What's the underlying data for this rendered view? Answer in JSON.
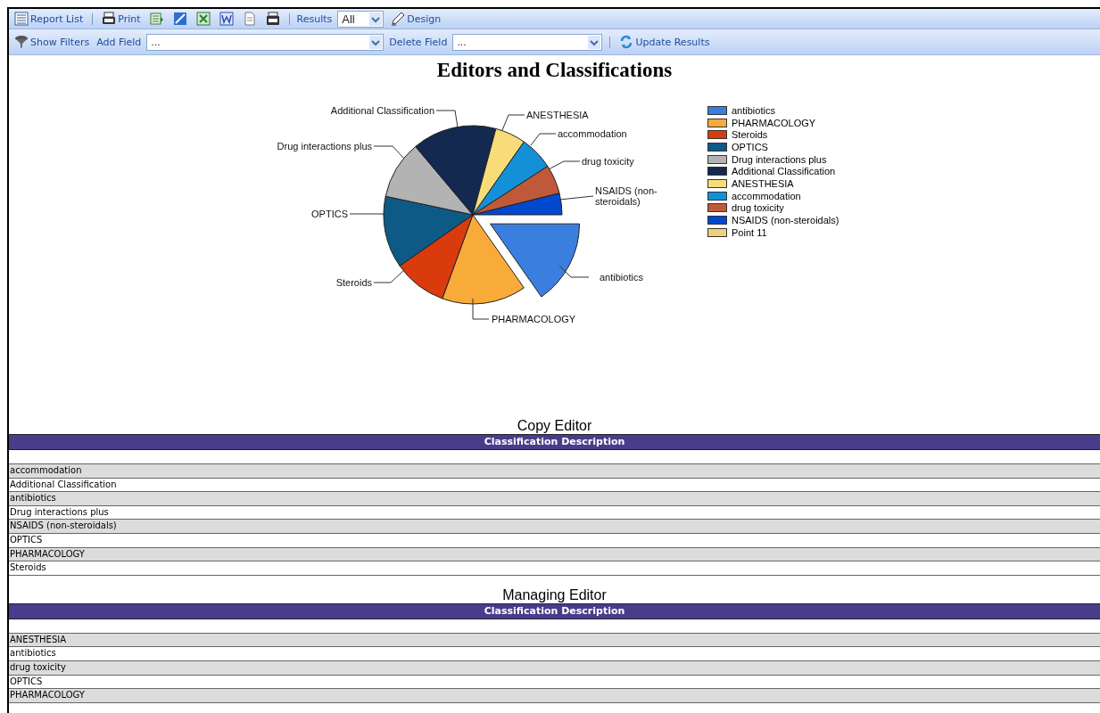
{
  "toolbar_top": [
    {
      "kind": "button",
      "label": "Report List"
    },
    {
      "kind": "separator"
    },
    {
      "kind": "button",
      "label": "Print"
    },
    {
      "kind": "icon"
    },
    {
      "kind": "icon"
    },
    {
      "kind": "icon"
    },
    {
      "kind": "icon"
    },
    {
      "kind": "icon"
    },
    {
      "kind": "icon"
    },
    {
      "kind": "separator"
    },
    {
      "kind": "label",
      "label": "Results"
    },
    {
      "kind": "select",
      "value": "All"
    },
    {
      "kind": "button",
      "label": "Design"
    }
  ],
  "toolbar_bottom": [
    {
      "kind": "button",
      "label": "Show Filters"
    },
    {
      "kind": "label",
      "label": "Add Field"
    },
    {
      "kind": "select",
      "value": "..."
    },
    {
      "kind": "label",
      "label": "Delete Field"
    },
    {
      "kind": "select",
      "value": "..."
    },
    {
      "kind": "separator"
    },
    {
      "kind": "button",
      "label": "Update Results"
    }
  ],
  "report_title": "Editors and Classifications",
  "pie_labels": [
    "Additional Classification",
    "ANESTHESIA",
    "accommodation",
    "Drug interactions plus",
    "drug toxicity",
    "NSAIDS (non-steroidals)",
    "OPTICS",
    "antibiotics",
    "Steroids",
    "PHARMACOLOGY"
  ],
  "legend": [
    {
      "label": "antibiotics",
      "color": "#3a7fe0"
    },
    {
      "label": "PHARMACOLOGY",
      "color": "#f9ab3a"
    },
    {
      "label": "Steroids",
      "color": "#d93b0c"
    },
    {
      "label": "OPTICS",
      "color": "#0e5a86"
    },
    {
      "label": "Drug interactions plus",
      "color": "#b3b3b3"
    },
    {
      "label": "Additional Classification",
      "color": "#13294f"
    },
    {
      "label": "ANESTHESIA",
      "color": "#f8dc7a"
    },
    {
      "label": "accommodation",
      "color": "#1490d6"
    },
    {
      "label": "drug toxicity",
      "color": "#c0593a"
    },
    {
      "label": "NSAIDS (non-steroidals)",
      "color": "#0049cf"
    },
    {
      "label": "Point 11",
      "color": "#f1cf7c"
    }
  ],
  "sections": [
    {
      "title": "Copy Editor",
      "column": "Classification Description",
      "rows": [
        "accommodation",
        "Additional Classification",
        "antibiotics",
        "Drug interactions plus",
        "NSAIDS (non-steroidals)",
        "OPTICS",
        "PHARMACOLOGY",
        "Steroids"
      ]
    },
    {
      "title": "Managing Editor",
      "column": "Classification Description",
      "rows": [
        "ANESTHESIA",
        "antibiotics",
        "drug toxicity",
        "OPTICS",
        "PHARMACOLOGY"
      ]
    }
  ]
}
